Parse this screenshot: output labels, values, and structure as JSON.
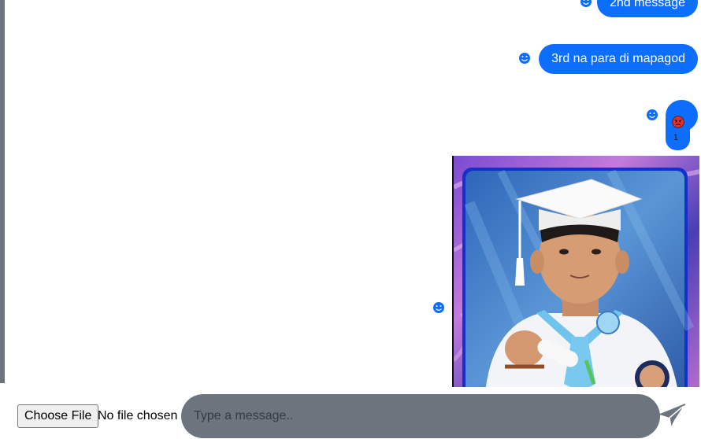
{
  "messages": [
    {
      "text": "2nd message"
    },
    {
      "text": "3rd na para di mapagod"
    },
    {
      "emoji": "angry-face-icon",
      "reaction_count": "1"
    },
    {
      "type": "image",
      "description_icon": "graduation-photo"
    }
  ],
  "composer": {
    "file_button_label": "Choose File",
    "file_status": "No file chosen",
    "input_placeholder": "Type a message.."
  },
  "colors": {
    "bubble": "#0d6efd",
    "input_bg": "#6c757d",
    "rail": "#6c757d",
    "send_icon": "#6c757d"
  }
}
